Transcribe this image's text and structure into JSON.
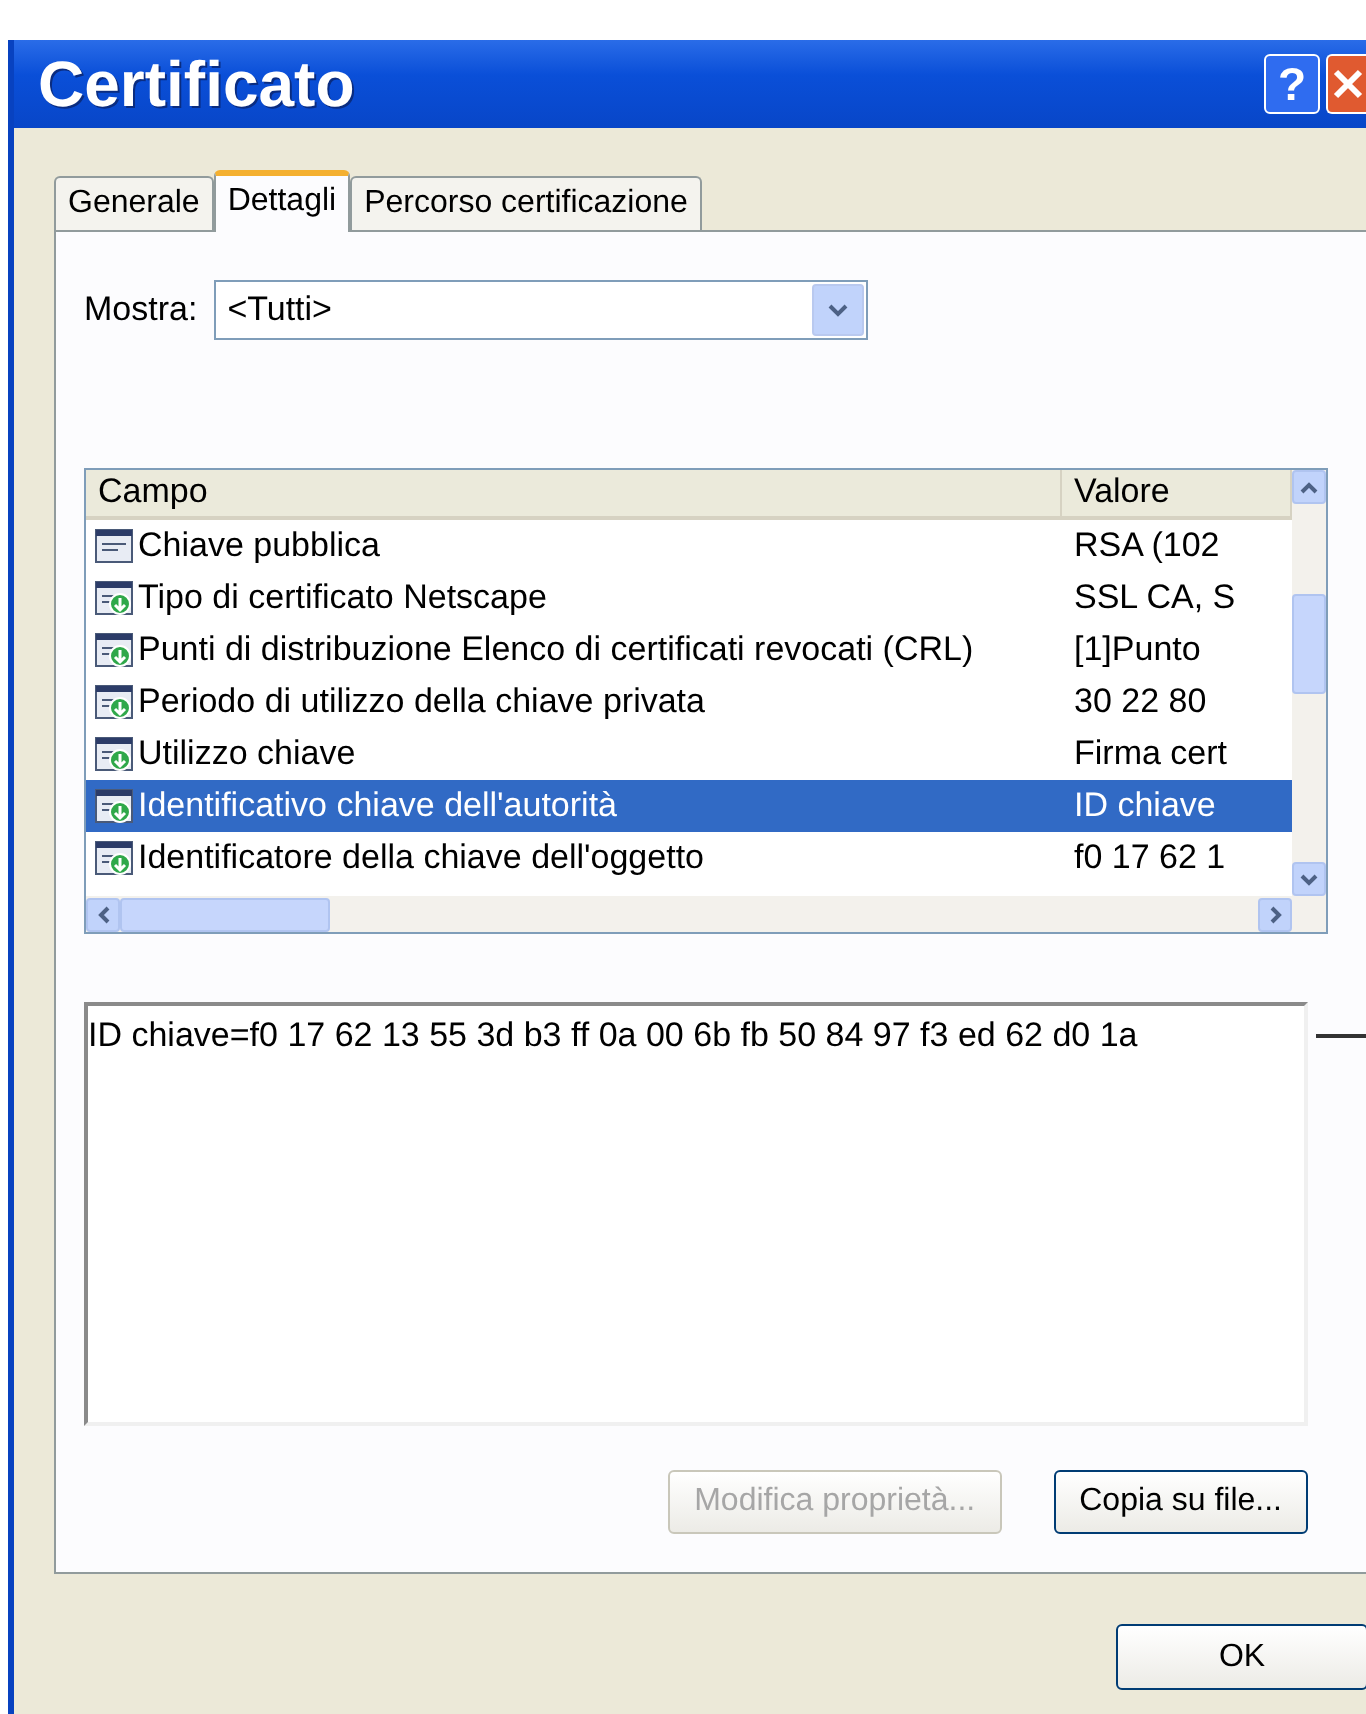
{
  "window": {
    "title": "Certificato",
    "help_button": "?"
  },
  "tabs": [
    {
      "label": "Generale",
      "selected": false
    },
    {
      "label": "Dettagli",
      "selected": true
    },
    {
      "label": "Percorso certificazione",
      "selected": false
    }
  ],
  "show_filter": {
    "label": "Mostra:",
    "value": "<Tutti>"
  },
  "fields_list": {
    "columns": [
      "Campo",
      "Valore"
    ],
    "rows": [
      {
        "kind": "plain",
        "field": "Chiave pubblica",
        "value": "RSA (102",
        "selected": false
      },
      {
        "kind": "extension",
        "field": "Tipo di certificato Netscape",
        "value": "SSL CA, S",
        "selected": false
      },
      {
        "kind": "extension",
        "field": "Punti di distribuzione Elenco di certificati revocati (CRL)",
        "value": "[1]Punto",
        "selected": false
      },
      {
        "kind": "extension",
        "field": "Periodo di utilizzo della chiave privata",
        "value": "30 22 80",
        "selected": false
      },
      {
        "kind": "extension",
        "field": "Utilizzo chiave",
        "value": "Firma cert",
        "selected": false
      },
      {
        "kind": "extension",
        "field": "Identificativo chiave dell'autorità",
        "value": "ID chiave",
        "selected": true
      },
      {
        "kind": "extension",
        "field": "Identificatore della chiave dell'oggetto",
        "value": "f0 17 62 1",
        "selected": false
      }
    ]
  },
  "detail_text": "ID chiave=f0 17 62 13 55 3d b3 ff 0a 00 6b fb 50 84 97 f3 ed 62 d0 1a",
  "buttons": [
    {
      "label": "Modifica proprietà...",
      "disabled": true
    },
    {
      "label": "Copia su file...",
      "disabled": false
    }
  ],
  "ok_button": "OK"
}
